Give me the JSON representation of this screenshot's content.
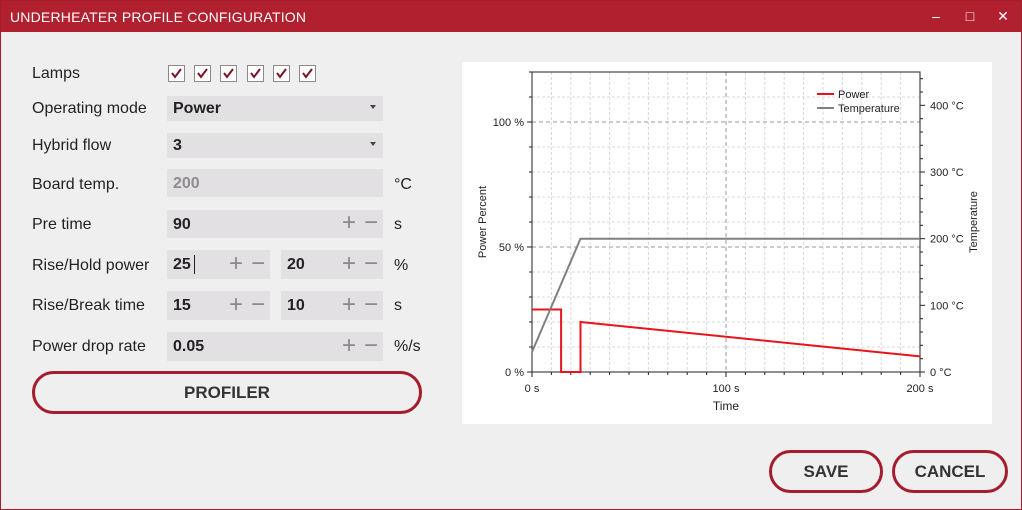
{
  "window": {
    "title": "UNDERHEATER PROFILE CONFIGURATION",
    "minimize_glyph": "‒",
    "maximize_glyph": "□",
    "close_glyph": "✕"
  },
  "form": {
    "lamps": {
      "label": "Lamps",
      "checked": [
        true,
        true,
        true,
        true,
        true,
        true
      ]
    },
    "operating_mode": {
      "label": "Operating mode",
      "value": "Power"
    },
    "hybrid_flow": {
      "label": "Hybrid flow",
      "value": "3"
    },
    "board_temp": {
      "label": "Board temp.",
      "value": "200",
      "unit": "°C"
    },
    "pre_time": {
      "label": "Pre time",
      "value": "90",
      "unit": "s"
    },
    "rise_hold_power": {
      "label": "Rise/Hold power",
      "rise": "25",
      "hold": "20",
      "unit": "%"
    },
    "rise_break_time": {
      "label": "Rise/Break time",
      "rise": "15",
      "break": "10",
      "unit": "s"
    },
    "power_drop_rate": {
      "label": "Power drop rate",
      "value": "0.05",
      "unit": "%/s"
    },
    "stepper": {
      "plus": "+",
      "minus": "−"
    }
  },
  "buttons": {
    "profiler": "PROFILER",
    "save": "SAVE",
    "cancel": "CANCEL"
  },
  "colors": {
    "accent": "#a51d2d",
    "power": "#e8141c",
    "temperature": "#808080"
  },
  "chart_data": {
    "type": "line",
    "xlabel": "Time",
    "ylabel_left": "Power Percent",
    "ylabel_right": "Temperature",
    "xlim": [
      0,
      200
    ],
    "ylim_left": [
      0,
      120
    ],
    "ylim_right": [
      0,
      450
    ],
    "x_ticks": [
      "0 s",
      "100 s",
      "200 s"
    ],
    "y_left_ticks": [
      "0 %",
      "50 %",
      "100 %"
    ],
    "y_right_ticks": [
      "0 °C",
      "100 °C",
      "200 °C",
      "300 °C",
      "400 °C"
    ],
    "grid": true,
    "legend_position": "top-right",
    "series": [
      {
        "name": "Power",
        "axis": "left",
        "x": [
          0,
          15,
          15,
          25,
          25,
          200
        ],
        "y": [
          25,
          25,
          0,
          0,
          20,
          6.25
        ]
      },
      {
        "name": "Temperature",
        "axis": "right",
        "x": [
          0,
          25,
          200
        ],
        "y": [
          30,
          200,
          200
        ]
      }
    ]
  }
}
